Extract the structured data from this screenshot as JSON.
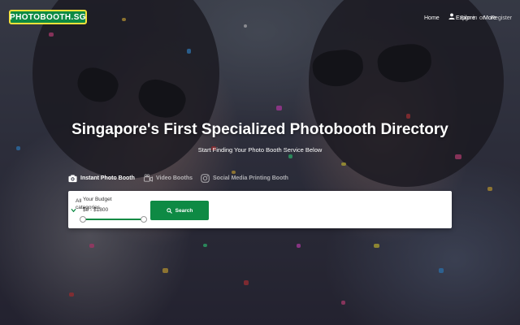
{
  "header": {
    "logo_text": "PHOTOBOOTH.SG",
    "nav": {
      "home": "Home",
      "explore": "Explore",
      "sign_in": "Sign in",
      "or": "or",
      "more": "More",
      "register": "Register"
    }
  },
  "hero": {
    "title": "Singapore's First Specialized Photobooth Directory",
    "subtitle": "Start Finding Your Photo Booth Service Below"
  },
  "tabs": [
    {
      "label": "Instant Photo Booth",
      "icon": "camera-icon",
      "active": true
    },
    {
      "label": "Video Booths",
      "icon": "video-camera-icon",
      "active": false
    },
    {
      "label": "Social Media Printing Booth",
      "icon": "instagram-icon",
      "active": false
    }
  ],
  "search": {
    "category_value": "All categories",
    "budget_label": "Your Budget",
    "budget_range": "$0 - $1800",
    "budget_min": 0,
    "budget_max": 1800,
    "button_label": "Search"
  },
  "colors": {
    "brand_green": "#0e8a44",
    "logo_border": "#f2e23a"
  }
}
